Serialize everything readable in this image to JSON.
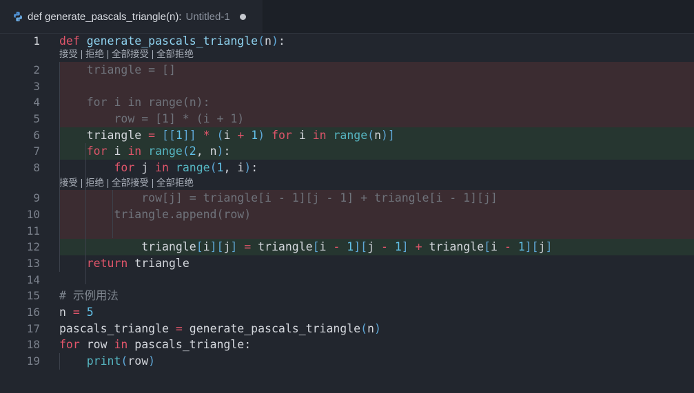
{
  "tab": {
    "title": "def generate_pascals_triangle(n):",
    "file": "Untitled-1",
    "icon": "python-icon"
  },
  "codelens": {
    "accept": "接受",
    "reject": "拒绝",
    "accept_all": "全部接受",
    "reject_all": "全部拒绝",
    "sep": " | "
  },
  "line_numbers": [
    "1",
    "2",
    "3",
    "4",
    "5",
    "6",
    "7",
    "8",
    "9",
    "10",
    "11",
    "12",
    "13",
    "14",
    "15",
    "16",
    "17",
    "18",
    "19"
  ],
  "lines": [
    [
      [
        "k",
        "def"
      ],
      [
        "t",
        " "
      ],
      [
        "f",
        "generate_pascals_triangle"
      ],
      [
        "p",
        "("
      ],
      [
        "t",
        "n"
      ],
      [
        "p",
        ")"
      ],
      [
        "t",
        ":"
      ]
    ],
    [
      [
        "t",
        "    triangle = []"
      ]
    ],
    [
      [
        "t",
        ""
      ]
    ],
    [
      [
        "t",
        "    for i in range(n):"
      ]
    ],
    [
      [
        "t",
        "        row = [1] * (i + 1)"
      ]
    ],
    [
      [
        "t",
        "    triangle "
      ],
      [
        "o",
        "="
      ],
      [
        "t",
        " "
      ],
      [
        "p",
        "[["
      ],
      [
        "n",
        "1"
      ],
      [
        "p",
        "]]"
      ],
      [
        "t",
        " "
      ],
      [
        "o",
        "*"
      ],
      [
        "t",
        " "
      ],
      [
        "p",
        "("
      ],
      [
        "t",
        "i "
      ],
      [
        "o",
        "+"
      ],
      [
        "t",
        " "
      ],
      [
        "n",
        "1"
      ],
      [
        "p",
        ")"
      ],
      [
        "t",
        " "
      ],
      [
        "k",
        "for"
      ],
      [
        "t",
        " i "
      ],
      [
        "k",
        "in"
      ],
      [
        "t",
        " "
      ],
      [
        "b",
        "range"
      ],
      [
        "p",
        "("
      ],
      [
        "t",
        "n"
      ],
      [
        "p",
        ")]"
      ]
    ],
    [
      [
        "t",
        "    "
      ],
      [
        "k",
        "for"
      ],
      [
        "t",
        " i "
      ],
      [
        "k",
        "in"
      ],
      [
        "t",
        " "
      ],
      [
        "b",
        "range"
      ],
      [
        "p",
        "("
      ],
      [
        "n",
        "2"
      ],
      [
        "t",
        ", n"
      ],
      [
        "p",
        ")"
      ],
      [
        "t",
        ":"
      ]
    ],
    [
      [
        "t",
        "        "
      ],
      [
        "k",
        "for"
      ],
      [
        "t",
        " j "
      ],
      [
        "k",
        "in"
      ],
      [
        "t",
        " "
      ],
      [
        "b",
        "range"
      ],
      [
        "p",
        "("
      ],
      [
        "n",
        "1"
      ],
      [
        "t",
        ", i"
      ],
      [
        "p",
        ")"
      ],
      [
        "t",
        ":"
      ]
    ],
    [
      [
        "t",
        "            row[j] = triangle[i - 1][j - 1] + triangle[i - 1][j]"
      ]
    ],
    [
      [
        "t",
        "        triangle.append(row)"
      ]
    ],
    [
      [
        "t",
        ""
      ]
    ],
    [
      [
        "t",
        "            triangle"
      ],
      [
        "p",
        "["
      ],
      [
        "t",
        "i"
      ],
      [
        "p",
        "]["
      ],
      [
        "t",
        "j"
      ],
      [
        "p",
        "]"
      ],
      [
        "t",
        " "
      ],
      [
        "o",
        "="
      ],
      [
        "t",
        " triangle"
      ],
      [
        "p",
        "["
      ],
      [
        "t",
        "i "
      ],
      [
        "o",
        "-"
      ],
      [
        "t",
        " "
      ],
      [
        "n",
        "1"
      ],
      [
        "p",
        "]["
      ],
      [
        "t",
        "j "
      ],
      [
        "o",
        "-"
      ],
      [
        "t",
        " "
      ],
      [
        "n",
        "1"
      ],
      [
        "p",
        "]"
      ],
      [
        "t",
        " "
      ],
      [
        "o",
        "+"
      ],
      [
        "t",
        " triangle"
      ],
      [
        "p",
        "["
      ],
      [
        "t",
        "i "
      ],
      [
        "o",
        "-"
      ],
      [
        "t",
        " "
      ],
      [
        "n",
        "1"
      ],
      [
        "p",
        "]["
      ],
      [
        "t",
        "j"
      ],
      [
        "p",
        "]"
      ]
    ],
    [
      [
        "t",
        "    "
      ],
      [
        "k",
        "return"
      ],
      [
        "t",
        " triangle"
      ]
    ],
    [
      [
        "t",
        ""
      ]
    ],
    [
      [
        "c",
        "# 示例用法"
      ]
    ],
    [
      [
        "t",
        "n "
      ],
      [
        "o",
        "="
      ],
      [
        "t",
        " "
      ],
      [
        "n",
        "5"
      ]
    ],
    [
      [
        "t",
        "pascals_triangle "
      ],
      [
        "o",
        "="
      ],
      [
        "t",
        " generate_pascals_triangle"
      ],
      [
        "p",
        "("
      ],
      [
        "t",
        "n"
      ],
      [
        "p",
        ")"
      ]
    ],
    [
      [
        "k",
        "for"
      ],
      [
        "t",
        " row "
      ],
      [
        "k",
        "in"
      ],
      [
        "t",
        " pascals_triangle:"
      ]
    ],
    [
      [
        "t",
        "    "
      ],
      [
        "b",
        "print"
      ],
      [
        "p",
        "("
      ],
      [
        "t",
        "row"
      ],
      [
        "p",
        ")"
      ]
    ]
  ],
  "colors": {
    "background": "#22262e",
    "removed_bg": "#3b2c31",
    "added_bg": "#263630",
    "keyword": "#e0556a",
    "builtin": "#56b6c2",
    "number": "#62c1e8",
    "function": "#8fd3f0"
  }
}
